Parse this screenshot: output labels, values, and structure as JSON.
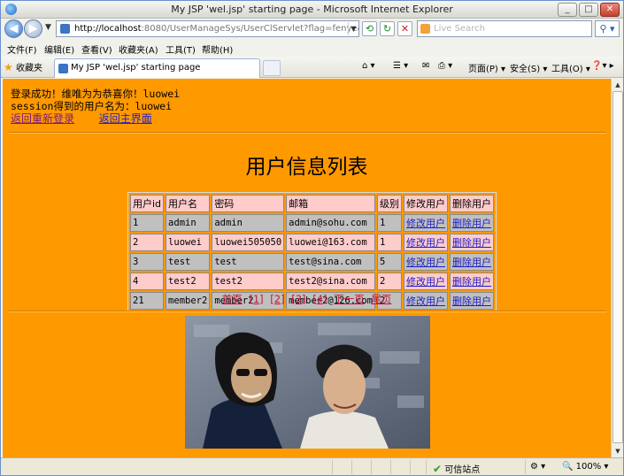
{
  "window": {
    "title": "My JSP 'wel.jsp' starting page - Microsoft Internet Explorer",
    "buttons": [
      "_",
      "□",
      "✕"
    ]
  },
  "address": {
    "url_host": "http://localhost",
    "url_rest": ":8080/UserManageSys/UserClServlet?flag=fenye&pageNow=1&us",
    "search_placeholder": "Live Search"
  },
  "menu": [
    "文件(F)",
    "编辑(E)",
    "查看(V)",
    "收藏夹(A)",
    "工具(T)",
    "帮助(H)"
  ],
  "favorites": {
    "label": "收藏夹",
    "tab_title": "My JSP 'wel.jsp' starting page",
    "commands": [
      "页面(P) ▾",
      "安全(S) ▾",
      "工具(O) ▾"
    ]
  },
  "content": {
    "welcome_line": "登录成功！维唯为为恭喜你！luowei",
    "session_line": "session得到的用户名为：luowei",
    "relogin_link": "返回重新登录",
    "home_link": "返回主界面",
    "heading": "用户信息列表",
    "table_headers": [
      "用户id",
      "用户名",
      "密码",
      "邮箱",
      "级别",
      "修改用户",
      "删除用户"
    ],
    "rows": [
      [
        "1",
        "admin",
        "admin",
        "admin@sohu.com",
        "1",
        "修改用户",
        "删除用户"
      ],
      [
        "2",
        "luowei",
        "luowei505050",
        "luowei@163.com",
        "1",
        "修改用户",
        "删除用户"
      ],
      [
        "3",
        "test",
        "test",
        "test@sina.com",
        "5",
        "修改用户",
        "删除用户"
      ],
      [
        "4",
        "test2",
        "test2",
        "test2@sina.com",
        "2",
        "修改用户",
        "删除用户"
      ],
      [
        "21",
        "member2",
        "member2",
        "member2@126.com",
        "2",
        "修改用户",
        "删除用户"
      ]
    ],
    "pager": [
      "首页",
      "[1]",
      "[2]",
      "[3]",
      "[4]",
      "下一页",
      "尾页"
    ]
  },
  "status": {
    "zone": "可信站点",
    "zoom": "100%"
  },
  "colors": {
    "page_bg": "#ff9900",
    "row_gray": "#c0c0c0",
    "row_pink": "#ffcccc",
    "link_blue": "#2020c8",
    "pager_red": "#c8143c"
  }
}
